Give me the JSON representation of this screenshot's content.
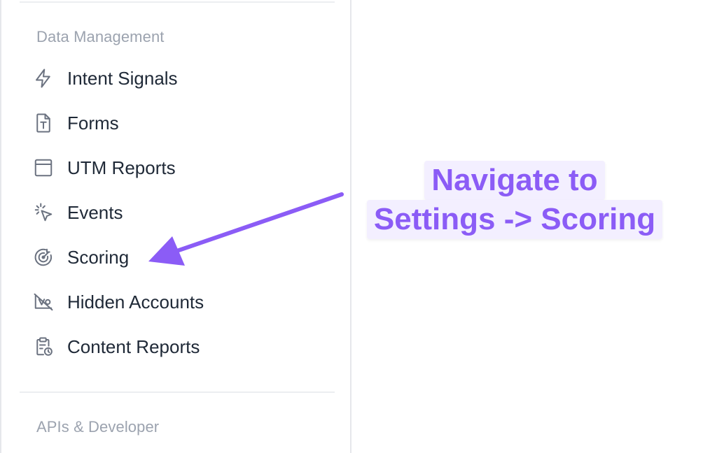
{
  "sections": {
    "data_management": {
      "title": "Data Management",
      "items": [
        {
          "label": "Intent Signals",
          "icon": "lightning-icon"
        },
        {
          "label": "Forms",
          "icon": "text-document-icon"
        },
        {
          "label": "UTM Reports",
          "icon": "browser-window-icon"
        },
        {
          "label": "Events",
          "icon": "cursor-click-icon"
        },
        {
          "label": "Scoring",
          "icon": "target-icon"
        },
        {
          "label": "Hidden Accounts",
          "icon": "hidden-view-icon"
        },
        {
          "label": "Content Reports",
          "icon": "clipboard-clock-icon"
        }
      ]
    },
    "apis": {
      "title": "APIs & Developer"
    }
  },
  "annotation": {
    "line1": "Navigate to",
    "line2": "Settings -> Scoring"
  },
  "colors": {
    "accent": "#8b5cf6",
    "annotation_bg": "#f3efff",
    "text": "#1f2937",
    "muted": "#9ca3af"
  }
}
